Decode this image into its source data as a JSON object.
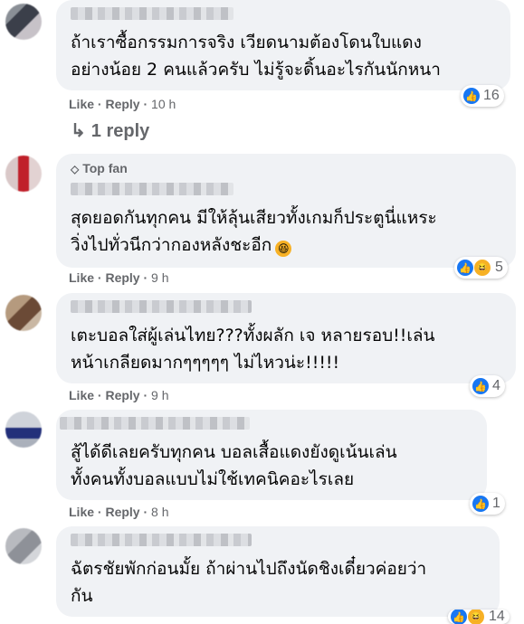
{
  "comments": [
    {
      "text": "ถ้าเราซื้อกรรมการจริง เวียดนามต้องโดนใบแดง\nอย่างน้อย 2 คนแล้วครับ ไม่รู้จะดิ้นอะไรกันนักหนา",
      "like_label": "Like",
      "reply_label": "Reply",
      "time": "10 h",
      "reaction_count": "16",
      "view_replies": "1 reply"
    },
    {
      "badge": "Top fan",
      "text": "สุดยอดกันทุกคน มีให้ลุ้นเสียวทั้งเกมก็ประตูนี่แหระ\nวิ่งไปทั่วนีกว่ากองหลังชะอีก",
      "like_label": "Like",
      "reply_label": "Reply",
      "time": "9 h",
      "reaction_count": "5"
    },
    {
      "text": "เตะบอลใส่ผู้เล่นไทย???ทั้งผลัก เจ หลายรอบ!!เล่น\nหน้าเกลียดมากๆๆๆๆๆ ไม่ไหวน่ะ!!!!!",
      "like_label": "Like",
      "reply_label": "Reply",
      "time": "9 h",
      "reaction_count": "4"
    },
    {
      "text": "สู้ได้ดีเลยครับทุกคน บอลเสื้อแดงยังดูเน้นเล่น\nทั้งคนทั้งบอลแบบไม่ใช้เทคนิคอะไรเลย",
      "like_label": "Like",
      "reply_label": "Reply",
      "time": "8 h",
      "reaction_count": "1"
    },
    {
      "text": "ฉัตรชัยพักก่อนมั้ย ถ้าผ่านไปถึงนัดชิงเดี๋ยวค่อยว่า\nกัน",
      "reaction_count": "14"
    }
  ],
  "colors": {
    "bubble": "#f0f2f5",
    "meta": "#65676b",
    "like_blue": "#1877f2",
    "haha_yellow": "#f7b125"
  }
}
